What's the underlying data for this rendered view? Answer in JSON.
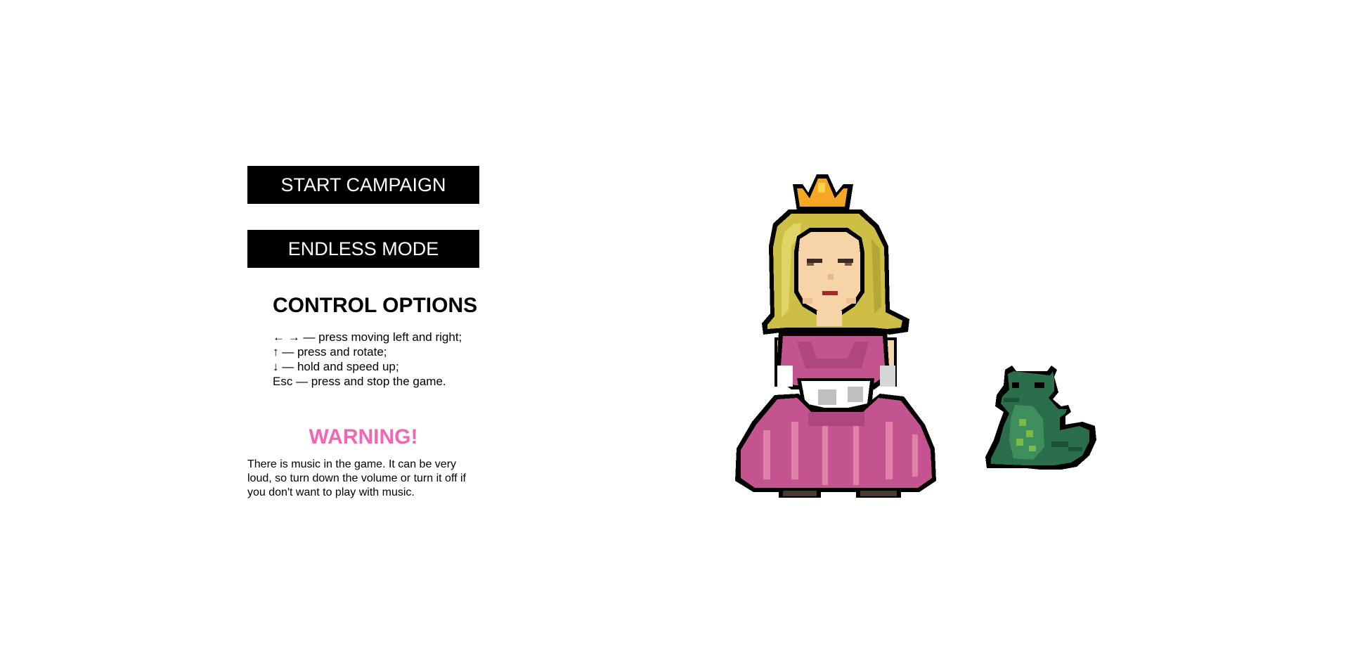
{
  "menu": {
    "start_campaign_label": "START CAMPAIGN",
    "endless_mode_label": "ENDLESS MODE"
  },
  "controls": {
    "title": "CONTROL OPTIONS",
    "items": [
      "← → — press moving left and right;",
      "↑ — press and rotate;",
      "↓ — hold and speed up;",
      "Esc — press and stop the game."
    ]
  },
  "warning": {
    "title": "WARNING!",
    "text": "There is music in the game. It can be very loud, so turn down the volume or turn it off if you don't want to play with music."
  },
  "colors": {
    "button_bg": "#000000",
    "button_text": "#ffffff",
    "warning": "#f067b3",
    "princess_dress": "#c4548f",
    "princess_hair": "#cdbf45",
    "crown": "#f5a623",
    "dragon": "#2a6e4c"
  },
  "illustration": {
    "princess": "pixel-art-princess",
    "dragon": "pixel-art-dragon"
  }
}
